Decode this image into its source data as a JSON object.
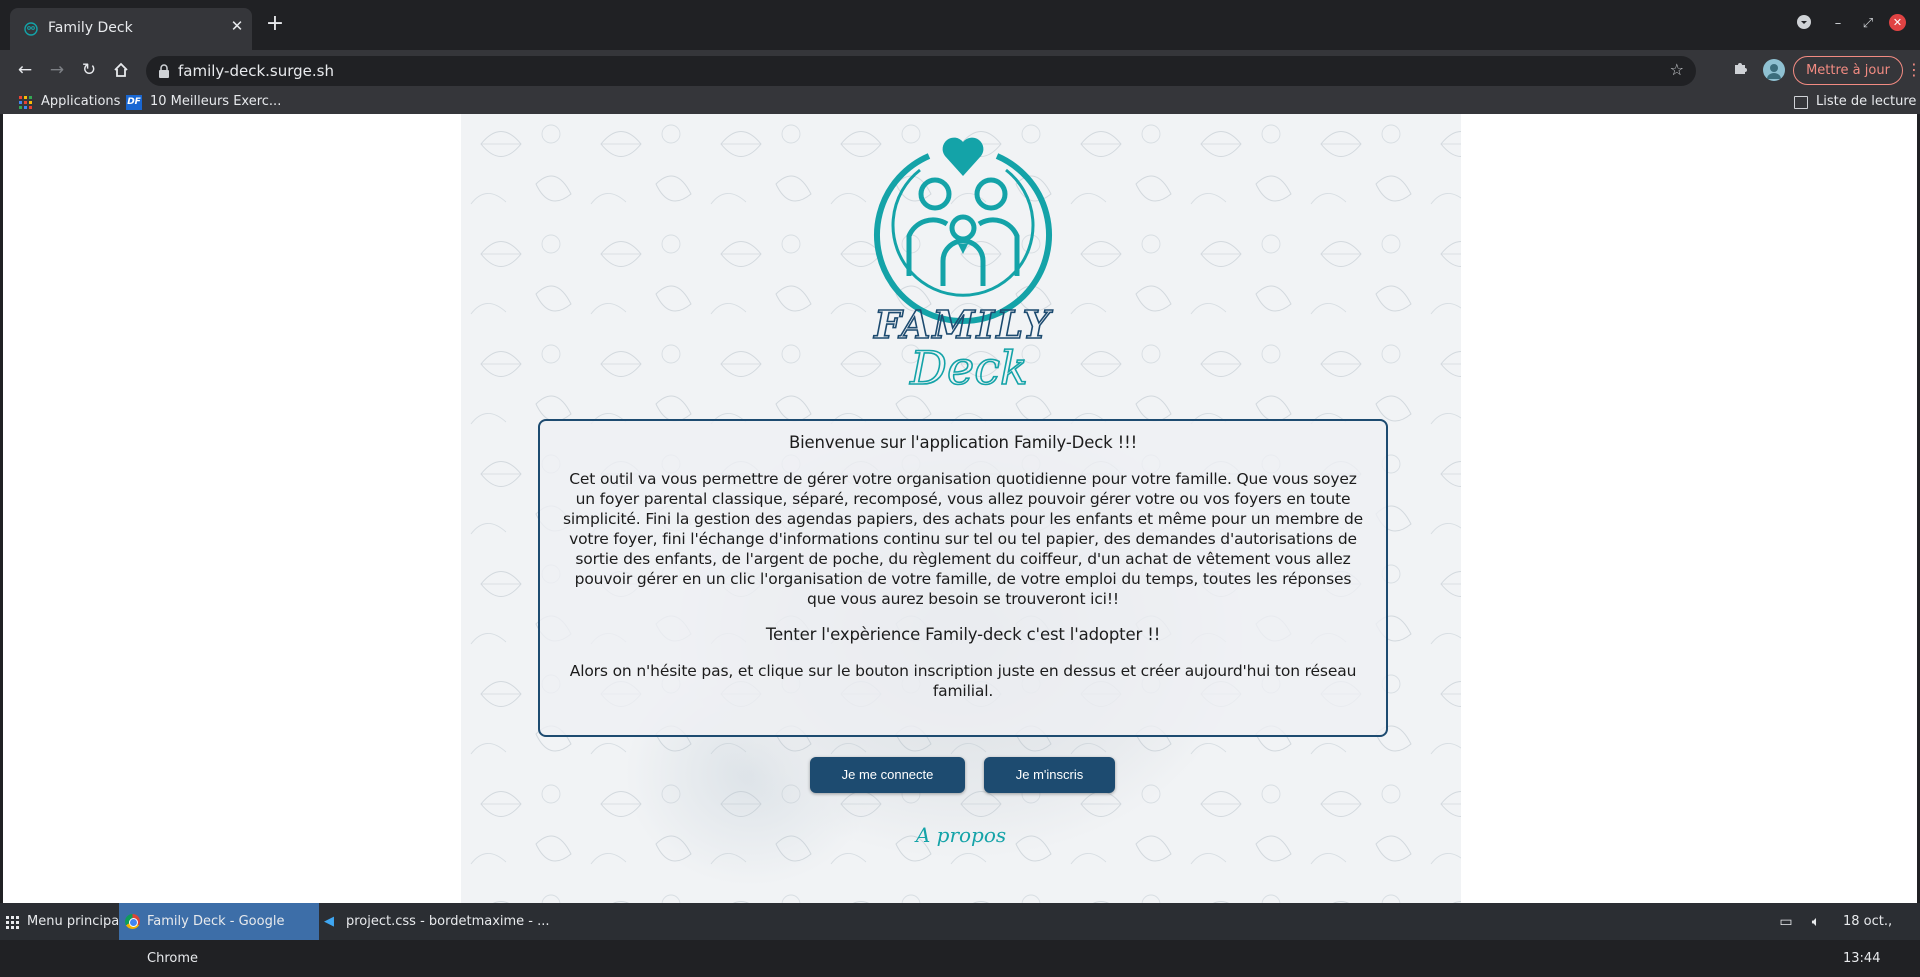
{
  "browser": {
    "tab_title": "Family Deck",
    "new_tab_symbol": "+",
    "url": "family-deck.surge.sh",
    "update_button": "Mettre à jour",
    "bookmarks": {
      "apps": "Applications",
      "df_icon_text": "DF",
      "df": "10 Meilleurs Exerc...",
      "reading_list": "Liste de lecture"
    }
  },
  "page": {
    "logo_title_line1": "FAMILY",
    "logo_title_line2": "Deck",
    "welcome": "Bienvenue sur l'application Family-Deck !!!",
    "body": "Cet outil va vous permettre de gérer votre organisation quotidienne pour votre famille. Que vous soyez un foyer parental classique, séparé, recomposé, vous allez pouvoir gérer votre ou vos foyers en toute simplicité. Fini la gestion des agendas papiers, des achats pour les enfants et même pour un membre de votre foyer, fini l'échange d'informations continu sur tel ou tel papier, des demandes d'autorisations de sortie des enfants, de l'argent de poche, du règlement du coiffeur, d'un achat de vêtement vous allez pouvoir gérer en un clic l'organisation de votre famille, de votre emploi du temps, toutes les réponses que vous aurez besoin se trouveront ici!!",
    "tagline": "Tenter l'expèrience Family-deck c'est l'adopter !!",
    "cta": "Alors on n'hésite pas, et clique sur le bouton inscription juste en dessus et créer aujourd'hui ton réseau familial.",
    "login_button": "Je me connecte",
    "signup_button": "Je m'inscris",
    "about_link": "A propos"
  },
  "taskbar": {
    "menu": "Menu principal",
    "chrome_window": "Family Deck - Google Chrome",
    "vscode_window": "project.css - bordetmaxime - ...",
    "clock": "18 oct., 13:44"
  },
  "colors": {
    "accent_teal": "#14a3a8",
    "brand_navy": "#1d4b70",
    "update_red": "#f28b82"
  }
}
